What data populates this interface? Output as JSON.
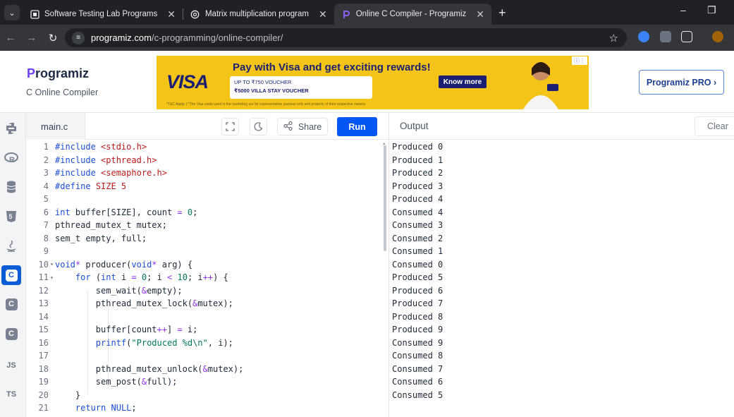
{
  "browser": {
    "tabs": [
      {
        "title": "Software Testing Lab Programs",
        "icon": "document-icon"
      },
      {
        "title": "Matrix multiplication program",
        "icon": "chatgpt-icon"
      },
      {
        "title": "Online C Compiler - Programiz",
        "icon": "programiz-icon"
      }
    ],
    "url_host": "programiz.com",
    "url_path": "/c-programming/online-compiler/"
  },
  "header": {
    "logo_p": "P",
    "logo_rest": "rogramiz",
    "subtitle": "C Online Compiler",
    "pro_label": "Programiz PRO ›"
  },
  "ad": {
    "brand": "VISA",
    "headline": "Pay with Visa and get exciting rewards!",
    "paytm_line": "UP TO ₹750 VOUCHER",
    "voucher_line": "₹5000 VILLA STAY VOUCHER",
    "cta": "Know more",
    "fine_print": "*T&C Apply. | *The Visa cards used in the marketing are for representation purpose only and property of their respective owners"
  },
  "sidebar": {
    "languages": [
      "python-icon",
      "r-icon",
      "sql-icon",
      "html-icon",
      "java-icon",
      "c-icon",
      "csharp-icon",
      "cpp-icon",
      "JS",
      "TS"
    ]
  },
  "editor": {
    "filename": "main.c",
    "share_label": "Share",
    "run_label": "Run",
    "lines": [
      {
        "n": "1",
        "code": "#include <stdio.h>"
      },
      {
        "n": "2",
        "code": "#include <pthread.h>"
      },
      {
        "n": "3",
        "code": "#include <semaphore.h>"
      },
      {
        "n": "4",
        "code": "#define SIZE 5"
      },
      {
        "n": "5",
        "code": ""
      },
      {
        "n": "6",
        "code": "int buffer[SIZE], count = 0;"
      },
      {
        "n": "7",
        "code": "pthread_mutex_t mutex;"
      },
      {
        "n": "8",
        "code": "sem_t empty, full;"
      },
      {
        "n": "9",
        "code": ""
      },
      {
        "n": "10",
        "code": "void* producer(void* arg) {"
      },
      {
        "n": "11",
        "code": "    for (int i = 0; i < 10; i++) {"
      },
      {
        "n": "12",
        "code": "        sem_wait(&empty);"
      },
      {
        "n": "13",
        "code": "        pthread_mutex_lock(&mutex);"
      },
      {
        "n": "14",
        "code": ""
      },
      {
        "n": "15",
        "code": "        buffer[count++] = i;"
      },
      {
        "n": "16",
        "code": "        printf(\"Produced %d\\n\", i);"
      },
      {
        "n": "17",
        "code": ""
      },
      {
        "n": "18",
        "code": "        pthread_mutex_unlock(&mutex);"
      },
      {
        "n": "19",
        "code": "        sem_post(&full);"
      },
      {
        "n": "20",
        "code": "    }"
      },
      {
        "n": "21",
        "code": "    return NULL;"
      }
    ]
  },
  "output": {
    "title": "Output",
    "clear_label": "Clear",
    "lines": [
      "Produced 0",
      "Produced 1",
      "Produced 2",
      "Produced 3",
      "Produced 4",
      "Consumed 4",
      "Consumed 3",
      "Consumed 2",
      "Consumed 1",
      "Consumed 0",
      "Produced 5",
      "Produced 6",
      "Produced 7",
      "Produced 8",
      "Produced 9",
      "Consumed 9",
      "Consumed 8",
      "Consumed 7",
      "Consumed 6",
      "Consumed 5"
    ]
  },
  "colors": {
    "run_button": "#0556f3",
    "active_language": "#0b5cd5",
    "browser_dark": "#202124"
  }
}
